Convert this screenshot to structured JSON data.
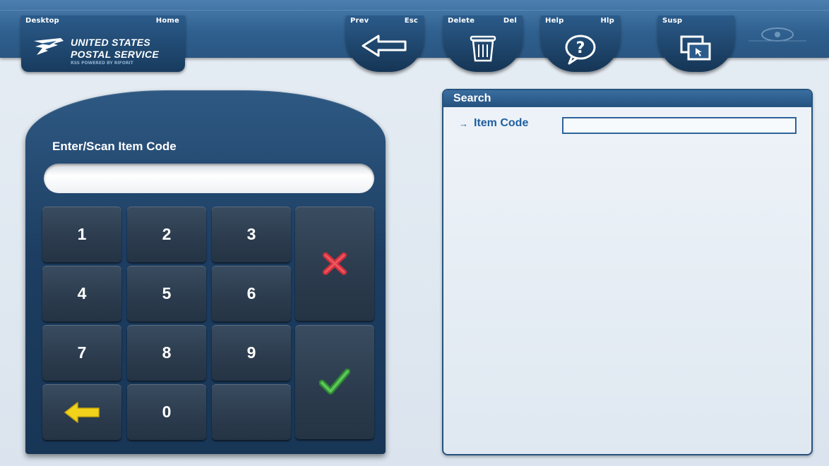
{
  "toolbar": {
    "home_tab": {
      "key_left": "Desktop",
      "key_right": "Home"
    },
    "brand": {
      "line1": "UNITED STATES",
      "line2": "POSTAL SERVICE",
      "subline": "RSS POWERED BY RIFORIT"
    },
    "prev": {
      "label": "Prev",
      "hotkey": "Esc"
    },
    "delete": {
      "label": "Delete",
      "hotkey": "Del"
    },
    "help": {
      "label": "Help",
      "hotkey": "Hlp"
    },
    "susp": {
      "label": "Susp",
      "hotkey": ""
    }
  },
  "keypad": {
    "title": "Enter/Scan Item Code",
    "input_value": "",
    "keys": [
      "1",
      "2",
      "3",
      "4",
      "5",
      "6",
      "7",
      "8",
      "9",
      "0"
    ],
    "cancel_icon": "red-x-icon",
    "enter_icon": "green-check-icon",
    "back_icon": "yellow-left-arrow-icon"
  },
  "search": {
    "header": "Search",
    "arrow": "→",
    "field_label": "Item Code",
    "field_value": ""
  },
  "colors": {
    "toolbar": "#2f608f",
    "panel": "#1d3e62",
    "key": "#2b3b4d",
    "accent_blue": "#1f5f9f",
    "cancel_red": "#d2303a",
    "enter_green": "#3aa63c",
    "back_yellow": "#f2d21a"
  }
}
